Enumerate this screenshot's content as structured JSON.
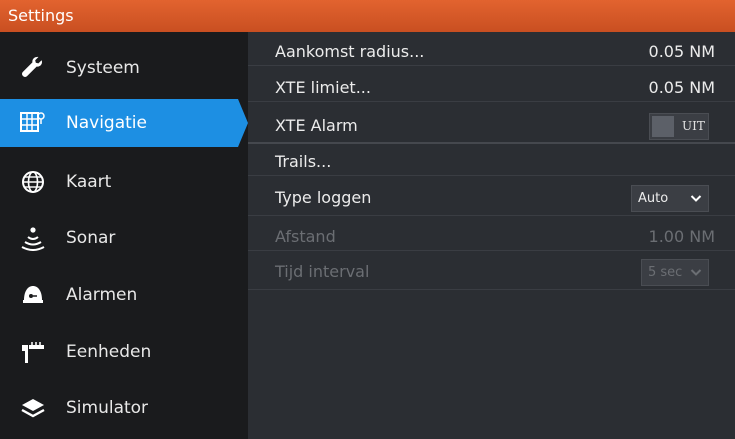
{
  "window": {
    "title": "Settings"
  },
  "sidebar": {
    "items": [
      {
        "label": "Systeem",
        "icon": "wrench-icon"
      },
      {
        "label": "Navigatie",
        "icon": "navigation-chart-icon",
        "selected": true
      },
      {
        "label": "Kaart",
        "icon": "globe-icon"
      },
      {
        "label": "Sonar",
        "icon": "sonar-icon"
      },
      {
        "label": "Alarmen",
        "icon": "alarm-bell-icon"
      },
      {
        "label": "Eenheden",
        "icon": "ruler-icon"
      },
      {
        "label": "Simulator",
        "icon": "layers-icon"
      }
    ]
  },
  "settings": {
    "arrival_radius": {
      "label": "Aankomst radius...",
      "value": "0.05 NM"
    },
    "xte_limit": {
      "label": "XTE limiet...",
      "value": "0.05 NM"
    },
    "xte_alarm": {
      "label": "XTE Alarm",
      "toggle_text": "UIT",
      "state": "off"
    },
    "trails": {
      "label": "Trails..."
    },
    "log_type": {
      "label": "Type loggen",
      "selected": "Auto"
    },
    "distance": {
      "label": "Afstand",
      "value": "1.00 NM",
      "disabled": true
    },
    "time_interval": {
      "label": "Tijd interval",
      "selected": "5 sec",
      "disabled": true
    }
  },
  "colors": {
    "titlebar": "#d95a28",
    "selected": "#1d8fe3",
    "sidebar_bg": "#1a1b1d",
    "content_bg": "#2b2e33"
  }
}
